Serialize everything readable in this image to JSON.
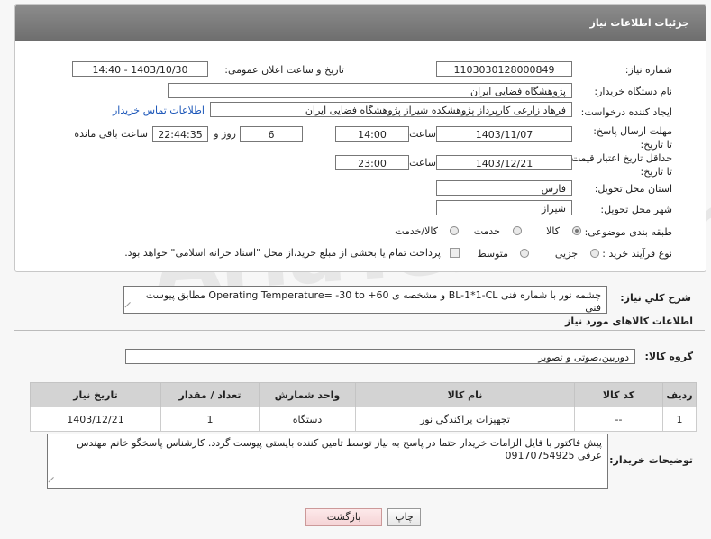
{
  "header": {
    "title": "جزئیات اطلاعات نیاز"
  },
  "labels": {
    "need_number": "شماره نیاز:",
    "announce_datetime": "تاریخ و ساعت اعلان عمومی:",
    "buyer_org": "نام دستگاه خریدار:",
    "requester": "ایجاد کننده درخواست:",
    "deadline": "مهلت ارسال پاسخ: تا تاریخ:",
    "time_word": "ساعت",
    "days_and": "روز و",
    "remaining": "ساعت باقی مانده",
    "price_validity": "حداقل تاریخ اعتبار قیمت: تا تاریخ:",
    "province": "استان محل تحویل:",
    "city": "شهر محل تحویل:",
    "category": "طبقه بندی موضوعی:",
    "process": "نوع فرآیند خرید :",
    "general_desc": "شرح کلي نياز:",
    "goods_info": "اطلاعات کالاهای مورد نیاز",
    "goods_group": "گروه کالا:",
    "buyer_notes": "توضیحات خریدار:"
  },
  "fields": {
    "need_number": "1103030128000849",
    "announce_datetime": "1403/10/30 - 14:40",
    "buyer_org": "پژوهشگاه فضایی ایران",
    "requester": "فرهاد زارعی کارپرداز پژوهشکده شیراز پژوهشگاه فضایی ایران",
    "contact_link": "اطلاعات تماس خریدار",
    "deadline_date": "1403/11/07",
    "deadline_time": "14:00",
    "deadline_days": "6",
    "deadline_remaining": "22:44:35",
    "price_date": "1403/12/21",
    "price_time": "23:00",
    "province": "فارس",
    "city": "شیراز",
    "category_options": [
      "کالا",
      "خدمت",
      "کالا/خدمت"
    ],
    "process_options": [
      "جزیی",
      "متوسط"
    ],
    "payment_note": "پرداخت تمام یا بخشی از مبلغ خرید،از محل \"اسناد خزانه اسلامی\" خواهد بود.",
    "general_desc": "چشمه نور با شماره فنی BL-1*1-CL و مشخصه ی Operating Temperature= -30 to +60 مطابق پیوست فنی",
    "goods_group": "دوربین،صوتی و تصویر",
    "buyer_notes": "پیش فاکتور با فایل الزامات خریدار حتما در پاسخ به نیاز توسط تامین کننده بایستی پیوست گردد. کارشناس پاسخگو خانم مهندس عرفی 09170754925"
  },
  "table": {
    "headers": [
      "ردیف",
      "کد کالا",
      "نام کالا",
      "واحد شمارش",
      "تعداد / مقدار",
      "تاریخ نیاز"
    ],
    "rows": [
      [
        "1",
        "--",
        "تجهیزات پراکندگی نور",
        "دستگاه",
        "1",
        "1403/12/21"
      ]
    ]
  },
  "buttons": {
    "print": "چاپ",
    "back": "بازگشت"
  },
  "watermark": "AriaTender.neT"
}
